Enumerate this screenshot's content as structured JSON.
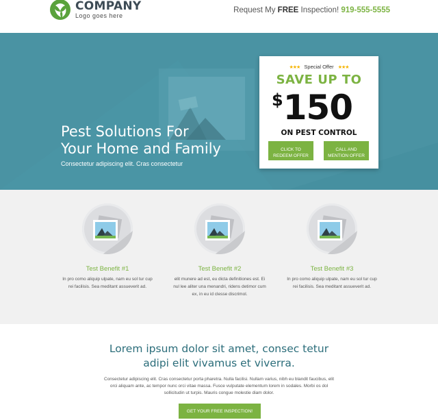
{
  "header": {
    "logo_name": "COMPANY",
    "logo_tagline": "Logo goes here",
    "cta_prefix": "Request My",
    "cta_free": "FREE",
    "cta_suffix": "Inspection!",
    "phone": "919-555-5555"
  },
  "hero": {
    "title_line1": "Pest Solutions For",
    "title_line2": "Your Home and Family",
    "subtitle": "Consectetur adipiscing elit. Cras consectetur"
  },
  "offer": {
    "stars_left": "★★★",
    "label": "Special Offer",
    "stars_right": "★★★",
    "save_text": "SAVE UP TO",
    "currency": "$",
    "amount": "150",
    "on_text": "ON PEST CONTROL",
    "btn1_line1": "CLICK TO",
    "btn1_line2": "REDEEM OFFER",
    "btn2_line1": "CALL AND",
    "btn2_line2": "MENTION OFFER"
  },
  "benefits": [
    {
      "title": "Test Benefit #1",
      "desc": "In pro como aliquip ulpate, nam eu sol tur cup rei facilisis. Sea meditant assueverit ad."
    },
    {
      "title": "Test Benefit #2",
      "desc": "elit munere ad est, eu dicta definitiones est. Ei nul lee aliter una menandri, ridens detimor cum ex, in eu id clesse discrimol."
    },
    {
      "title": "Test Benefit #3",
      "desc": "In pro como aliquip ulpate, nam eu sol tur cup rei facilisis. Sea meditant assueverit ad."
    }
  ],
  "bottom": {
    "headline_line1": "Lorem ipsum dolor sit amet, consec tetur",
    "headline_line2": "adipi elit vivamus et viverra.",
    "body": "Consectetur adipiscing elit. Cras consectetur porta pharetra. Nulla facilisi. Nullam varius, nibh eu blandit faucibus, elit orci aliquam ante, ac tempor nunc orci vitae massa. Fusce vulputate elementum lorem in sodales. Morbi os dol sollicitudin ut turpis. Mauris congue molestie diam dolor.",
    "button": "GET YOUR FREE INSPECTION!"
  },
  "colors": {
    "accent_green": "#7cb342",
    "hero_teal": "#4a93a3",
    "headline_teal": "#2b6d7a"
  }
}
